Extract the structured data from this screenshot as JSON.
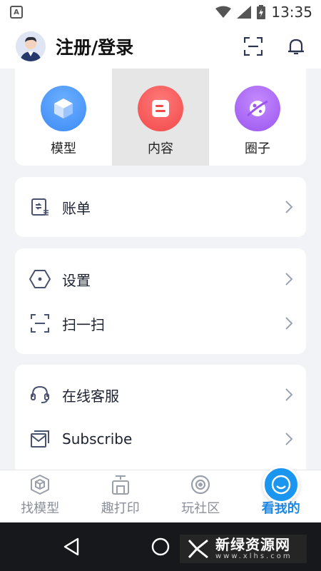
{
  "status_bar": {
    "time": "13:35",
    "app_badge": "A"
  },
  "header": {
    "title": "注册/登录"
  },
  "quick_actions": [
    {
      "label": "模型",
      "icon": "cube-icon",
      "color": "#3d8af7"
    },
    {
      "label": "内容",
      "icon": "document-icon",
      "color": "#f25252"
    },
    {
      "label": "圈子",
      "icon": "planet-icon",
      "color": "#a05cf0"
    }
  ],
  "menu": {
    "bill": {
      "label": "账单",
      "icon": "bill-icon"
    },
    "settings": {
      "label": "设置",
      "icon": "hexagon-icon"
    },
    "scan": {
      "label": "扫一扫",
      "icon": "scan-icon"
    },
    "service": {
      "label": "在线客服",
      "icon": "headset-icon"
    },
    "subscribe": {
      "label": "Subscribe",
      "icon": "mail-icon"
    }
  },
  "bottom_nav": [
    {
      "label": "找模型",
      "icon": "cube-outline-icon"
    },
    {
      "label": "趣打印",
      "icon": "printer-icon"
    },
    {
      "label": "玩社区",
      "icon": "community-icon"
    },
    {
      "label": "看我的",
      "icon": "smile-icon",
      "active": true
    }
  ],
  "watermark": {
    "main": "新绿资源网",
    "sub": "www.xlhs.com"
  },
  "colors": {
    "accent": "#1e88e5",
    "icon_stroke": "#4a5270",
    "chevron": "#9aa3b5"
  }
}
